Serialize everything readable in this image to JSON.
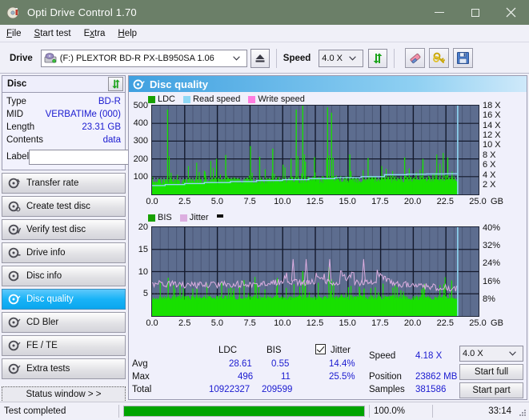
{
  "window": {
    "title": "Opti Drive Control 1.70",
    "icon": "disc-icon",
    "minimize": "—",
    "maximize": "□",
    "close": "✕"
  },
  "menu": {
    "items": [
      {
        "label": "File",
        "accel": "F"
      },
      {
        "label": "Start test",
        "accel": "S"
      },
      {
        "label": "Extra",
        "accel": "x"
      },
      {
        "label": "Help",
        "accel": "H"
      }
    ]
  },
  "toolbar": {
    "drive_label": "Drive",
    "drive_value": "(F:)  PLEXTOR BD-R  PX-LB950SA 1.06",
    "eject_icon": "eject-icon",
    "speed_label": "Speed",
    "speed_value": "4.0 X",
    "refresh_icon": "refresh-icon",
    "eraser_icon": "eraser-icon",
    "keys_icon": "keys-icon",
    "save_icon": "save-icon",
    "dropdown_arrow": "⌄"
  },
  "disc_panel": {
    "title": "Disc",
    "refresh_icon": "refresh-icon",
    "rows": [
      {
        "key": "Type",
        "value": "BD-R"
      },
      {
        "key": "MID",
        "value": "VERBATIMe (000)"
      },
      {
        "key": "Length",
        "value": "23.31 GB"
      },
      {
        "key": "Contents",
        "value": "data"
      }
    ],
    "label_key": "Label",
    "label_value": "",
    "label_placeholder": "",
    "cd_icon": "cd-icon"
  },
  "nav": {
    "items": [
      {
        "label": "Transfer rate",
        "icon": "disc-test-icon",
        "selected": false
      },
      {
        "label": "Create test disc",
        "icon": "disc-test-icon",
        "selected": false
      },
      {
        "label": "Verify test disc",
        "icon": "disc-test-icon",
        "selected": false
      },
      {
        "label": "Drive info",
        "icon": "disc-test-icon",
        "selected": false
      },
      {
        "label": "Disc info",
        "icon": "disc-test-icon",
        "selected": false
      },
      {
        "label": "Disc quality",
        "icon": "disc-test-icon",
        "selected": true
      },
      {
        "label": "CD Bler",
        "icon": "disc-test-icon",
        "selected": false
      },
      {
        "label": "FE / TE",
        "icon": "disc-test-icon",
        "selected": false
      },
      {
        "label": "Extra tests",
        "icon": "disc-test-icon",
        "selected": false
      }
    ],
    "status_window": "Status window > >"
  },
  "panel": {
    "title": "Disc quality",
    "icon": "disc-quality-icon"
  },
  "stats": {
    "col_headers": [
      "LDC",
      "BIS"
    ],
    "row_labels": [
      "Avg",
      "Max",
      "Total"
    ],
    "ldc": {
      "avg": "28.61",
      "max": "496",
      "total": "10922327"
    },
    "bis": {
      "avg": "0.55",
      "max": "11",
      "total": "209599"
    },
    "jitter": {
      "label": "Jitter",
      "checked": true,
      "avg": "14.4%",
      "max": "25.5%"
    },
    "speed_label": "Speed",
    "speed_value": "4.18 X",
    "position_label": "Position",
    "position_value": "23862 MB",
    "samples_label": "Samples",
    "samples_value": "381586",
    "speed_select": "4.0 X",
    "start_full": "Start full",
    "start_part": "Start part",
    "dropdown_arrow": "⌄"
  },
  "statusbar": {
    "message": "Test completed",
    "progress_percent": "100.0%",
    "progress_value": 100,
    "elapsed": "33:14"
  },
  "colors": {
    "titlebar": "#6b7f68",
    "accent_header": "#3fa0e0",
    "plot_bg": "#5d6d8f",
    "grid": "#1e2436",
    "ldc_green": "#18e000",
    "read_speed": "#8fd8f5",
    "write_speed": "#ff7de0",
    "jitter_pink": "#dcaee0",
    "value_blue": "#1a1ad0",
    "progress_green": "#00a400"
  },
  "chart_data": [
    {
      "type": "area",
      "id": "ldc-chart",
      "title": "Disc quality",
      "xlabel": "GB",
      "ylabel": "LDC",
      "xlim": [
        0.0,
        25.0
      ],
      "xticks": [
        "0.0",
        "2.5",
        "5.0",
        "7.5",
        "10.0",
        "12.5",
        "15.0",
        "17.5",
        "20.0",
        "22.5",
        "25.0"
      ],
      "xtick_values": [
        0.0,
        2.5,
        5.0,
        7.5,
        10.0,
        12.5,
        15.0,
        17.5,
        20.0,
        22.5,
        25.0
      ],
      "x_unit": "GB",
      "ylim": [
        0,
        500
      ],
      "yticks": [
        "100",
        "200",
        "300",
        "400",
        "500"
      ],
      "ytick_values": [
        100,
        200,
        300,
        400,
        500
      ],
      "y2lim": [
        0,
        18
      ],
      "y2ticks": [
        "2 X",
        "4 X",
        "6 X",
        "8 X",
        "10 X",
        "12 X",
        "14 X",
        "16 X",
        "18 X"
      ],
      "y2tick_values": [
        2,
        4,
        6,
        8,
        10,
        12,
        14,
        16,
        18
      ],
      "grid": true,
      "legend_position": "top-left",
      "legend": [
        {
          "name": "LDC",
          "color": "#18e000"
        },
        {
          "name": "Read speed",
          "color": "#8fd8f5"
        },
        {
          "name": "Write speed",
          "color": "#ff7de0"
        }
      ],
      "data_end_gb": 23.4,
      "series": [
        {
          "name": "LDC",
          "color": "#18e000",
          "type": "bars",
          "baseline_band": [
            55,
            90
          ],
          "spikes_gb": [
            1.15,
            4.9,
            5.6,
            7.5,
            8.2,
            9.2,
            10.6,
            11.0,
            11.5,
            12.4,
            13.4,
            13.7,
            15.1,
            16.5,
            19.3,
            20.7,
            22.6
          ],
          "spikes_value": [
            478,
            200,
            222,
            272,
            212,
            258,
            200,
            478,
            500,
            210,
            490,
            460,
            225,
            205,
            208,
            200,
            208
          ]
        },
        {
          "name": "Read speed",
          "color": "#8fd8f5",
          "type": "line",
          "x": [
            0.0,
            1.0,
            2.5,
            4.0,
            6.0,
            8.0,
            10.0,
            12.0,
            14.0,
            16.0,
            17.8,
            19.5,
            21.0,
            22.5,
            23.4
          ],
          "values": [
            1.8,
            2.0,
            2.2,
            2.4,
            2.6,
            2.8,
            3.0,
            3.2,
            3.4,
            3.6,
            4.0,
            4.1,
            4.15,
            4.18,
            4.18
          ]
        },
        {
          "name": "Write speed",
          "color": "#ff7de0",
          "type": "line",
          "x": [],
          "values": []
        }
      ]
    },
    {
      "type": "area",
      "id": "bis-chart",
      "xlabel": "GB",
      "ylabel": "BIS",
      "xlim": [
        0.0,
        25.0
      ],
      "xticks": [
        "0.0",
        "2.5",
        "5.0",
        "7.5",
        "10.0",
        "12.5",
        "15.0",
        "17.5",
        "20.0",
        "22.5",
        "25.0"
      ],
      "xtick_values": [
        0.0,
        2.5,
        5.0,
        7.5,
        10.0,
        12.5,
        15.0,
        17.5,
        20.0,
        22.5,
        25.0
      ],
      "x_unit": "GB",
      "ylim": [
        0,
        20
      ],
      "yticks": [
        "5",
        "10",
        "15",
        "20"
      ],
      "ytick_values": [
        5,
        10,
        15,
        20
      ],
      "y2lim": [
        0,
        40
      ],
      "y2ticks": [
        "8%",
        "16%",
        "24%",
        "32%",
        "40%"
      ],
      "y2tick_values": [
        8,
        16,
        24,
        32,
        40
      ],
      "grid": true,
      "legend_position": "top-left",
      "legend": [
        {
          "name": "BIS",
          "color": "#18e000"
        },
        {
          "name": "Jitter",
          "color": "#dcaee0"
        }
      ],
      "data_end_gb": 23.4,
      "series": [
        {
          "name": "BIS",
          "color": "#18e000",
          "type": "bars",
          "baseline_band": [
            3.6,
            4.6
          ],
          "spikes_gb": [
            1.2,
            3.4,
            6.0,
            8.6,
            11.5,
            11.7,
            13.5,
            13.7,
            15.0,
            16.2,
            18.4,
            20.6,
            22.3,
            22.9
          ],
          "spikes_value": [
            8.6,
            6.2,
            6.4,
            6.0,
            10.1,
            7.5,
            11.0,
            8.3,
            6.5,
            6.2,
            6.4,
            6.0,
            7.2,
            8.0
          ]
        },
        {
          "name": "Jitter",
          "color": "#dcaee0",
          "type": "line",
          "mean_percent": 14.4,
          "max_percent": 25.5,
          "x": [
            0.0,
            2.0,
            4.0,
            6.0,
            8.0,
            10.0,
            10.8,
            11.8,
            13.0,
            13.6,
            15.0,
            16.2,
            18.0,
            19.5,
            21.0,
            22.5,
            23.4
          ],
          "values": [
            7.3,
            7.1,
            6.9,
            7.1,
            7.2,
            7.6,
            12.8,
            12.8,
            7.9,
            12.8,
            8.0,
            12.8,
            7.8,
            7.0,
            6.6,
            6.4,
            6.1
          ]
        }
      ]
    }
  ]
}
